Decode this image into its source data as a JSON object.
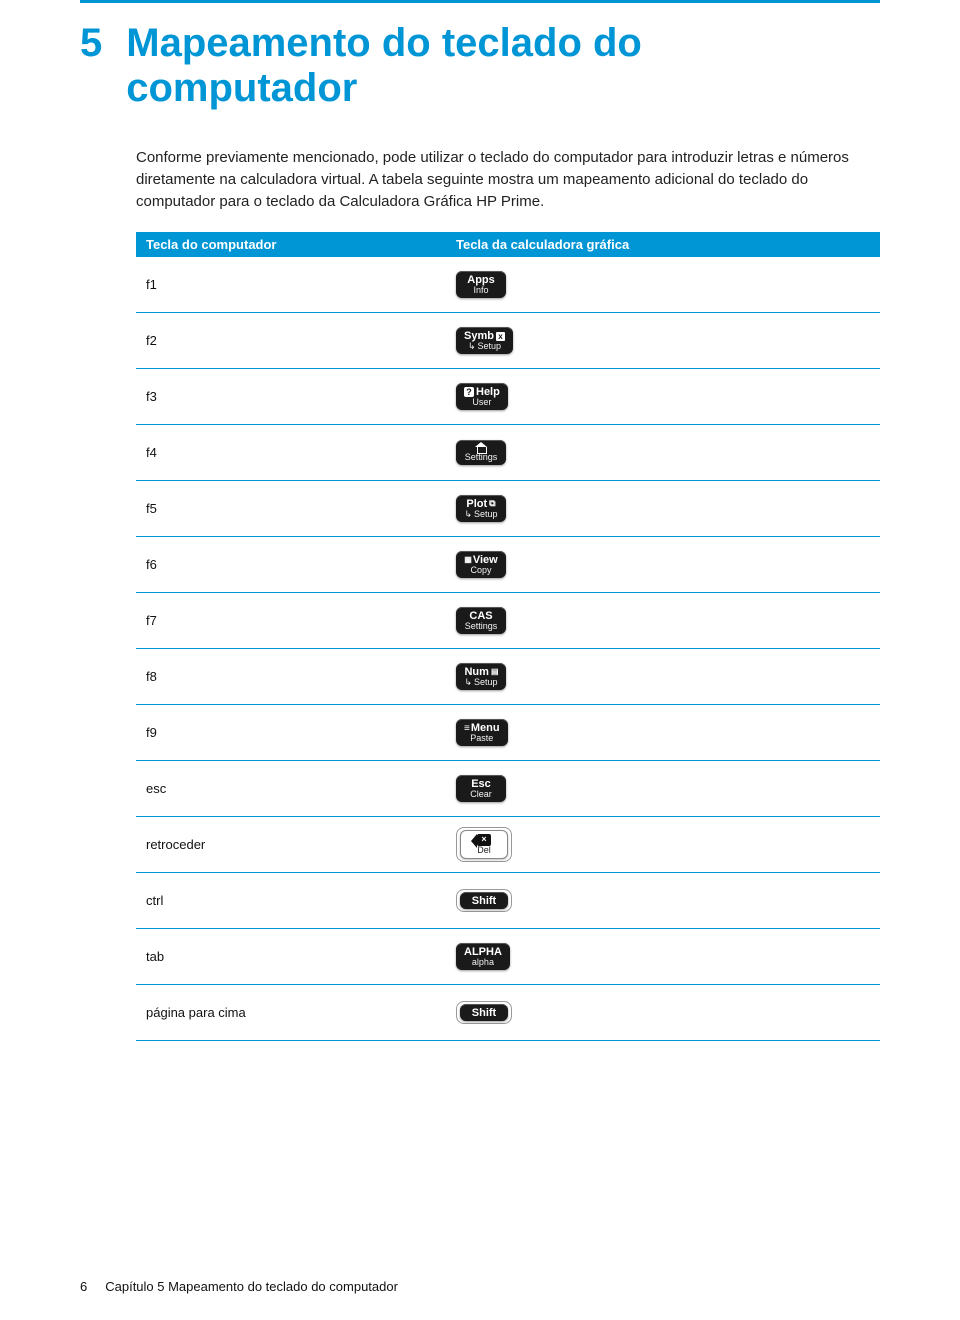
{
  "chapter": {
    "number": "5",
    "title": "Mapeamento do teclado do computador"
  },
  "intro": "Conforme previamente mencionado, pode utilizar o teclado do computador para introduzir letras e números diretamente na calculadora virtual. A tabela seguinte mostra um mapeamento adicional do teclado do computador para o teclado da Calculadora Gráfica HP Prime.",
  "table": {
    "header_computer": "Tecla do computador",
    "header_calc": "Tecla da calculadora gráfica",
    "rows": [
      {
        "computer_key": "f1",
        "calc_line1": "Apps",
        "calc_line2": "Info",
        "style": "black",
        "icon": "none"
      },
      {
        "computer_key": "f2",
        "calc_line1": "Symb",
        "calc_line2": "Setup",
        "style": "black",
        "icon": "symb"
      },
      {
        "computer_key": "f3",
        "calc_line1": "Help",
        "calc_line2": "User",
        "style": "black",
        "icon": "help"
      },
      {
        "computer_key": "f4",
        "calc_line1": "",
        "calc_line2": "Settings",
        "style": "black",
        "icon": "home"
      },
      {
        "computer_key": "f5",
        "calc_line1": "Plot",
        "calc_line2": "Setup",
        "style": "black",
        "icon": "plot"
      },
      {
        "computer_key": "f6",
        "calc_line1": "View",
        "calc_line2": "Copy",
        "style": "black",
        "icon": "view"
      },
      {
        "computer_key": "f7",
        "calc_line1": "CAS",
        "calc_line2": "Settings",
        "style": "black",
        "icon": "none"
      },
      {
        "computer_key": "f8",
        "calc_line1": "Num",
        "calc_line2": "Setup",
        "style": "black",
        "icon": "num"
      },
      {
        "computer_key": "f9",
        "calc_line1": "Menu",
        "calc_line2": "Paste",
        "style": "black",
        "icon": "menu"
      },
      {
        "computer_key": "esc",
        "calc_line1": "Esc",
        "calc_line2": "Clear",
        "style": "black",
        "icon": "none"
      },
      {
        "computer_key": "retroceder",
        "calc_line1": "",
        "calc_line2": "Del",
        "style": "white-outline",
        "icon": "backspace"
      },
      {
        "computer_key": "ctrl",
        "calc_line1": "Shift",
        "calc_line2": "",
        "style": "white-outline-black",
        "icon": "none"
      },
      {
        "computer_key": "tab",
        "calc_line1": "ALPHA",
        "calc_line2": "alpha",
        "style": "black",
        "icon": "none"
      },
      {
        "computer_key": "página para cima",
        "calc_line1": "Shift",
        "calc_line2": "",
        "style": "white-outline-black",
        "icon": "none"
      }
    ]
  },
  "footer": {
    "page_number": "6",
    "chapter_ref": "Capítulo 5   Mapeamento do teclado do computador"
  }
}
